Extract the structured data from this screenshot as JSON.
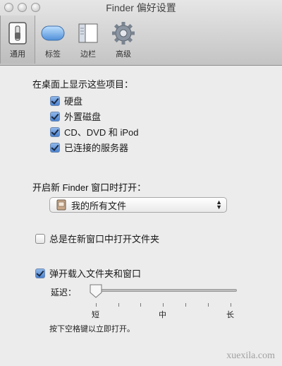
{
  "window": {
    "title": "Finder 偏好设置"
  },
  "toolbar": {
    "items": [
      {
        "label": "通用",
        "icon": "switch-icon",
        "selected": true
      },
      {
        "label": "标签",
        "icon": "tag-icon"
      },
      {
        "label": "边栏",
        "icon": "sidebar-icon"
      },
      {
        "label": "高级",
        "icon": "gear-icon"
      }
    ]
  },
  "desktop": {
    "heading": "在桌面上显示这些项目：",
    "items": [
      {
        "label": "硬盘",
        "checked": true
      },
      {
        "label": "外置磁盘",
        "checked": true
      },
      {
        "label": "CD、DVD 和 iPod",
        "checked": true
      },
      {
        "label": "已连接的服务器",
        "checked": true
      }
    ]
  },
  "new_window": {
    "heading": "开启新 Finder 窗口时打开：",
    "selected": "我的所有文件"
  },
  "open_folders": {
    "label": "总是在新窗口中打开文件夹",
    "checked": false
  },
  "spring_loaded": {
    "label": "弹开载入文件夹和窗口",
    "checked": true,
    "delay_label": "延迟：",
    "delay_value": 0,
    "ticks": [
      "短",
      "中",
      "长"
    ],
    "hint": "按下空格键以立即打开。"
  },
  "watermark": "xuexila.com"
}
